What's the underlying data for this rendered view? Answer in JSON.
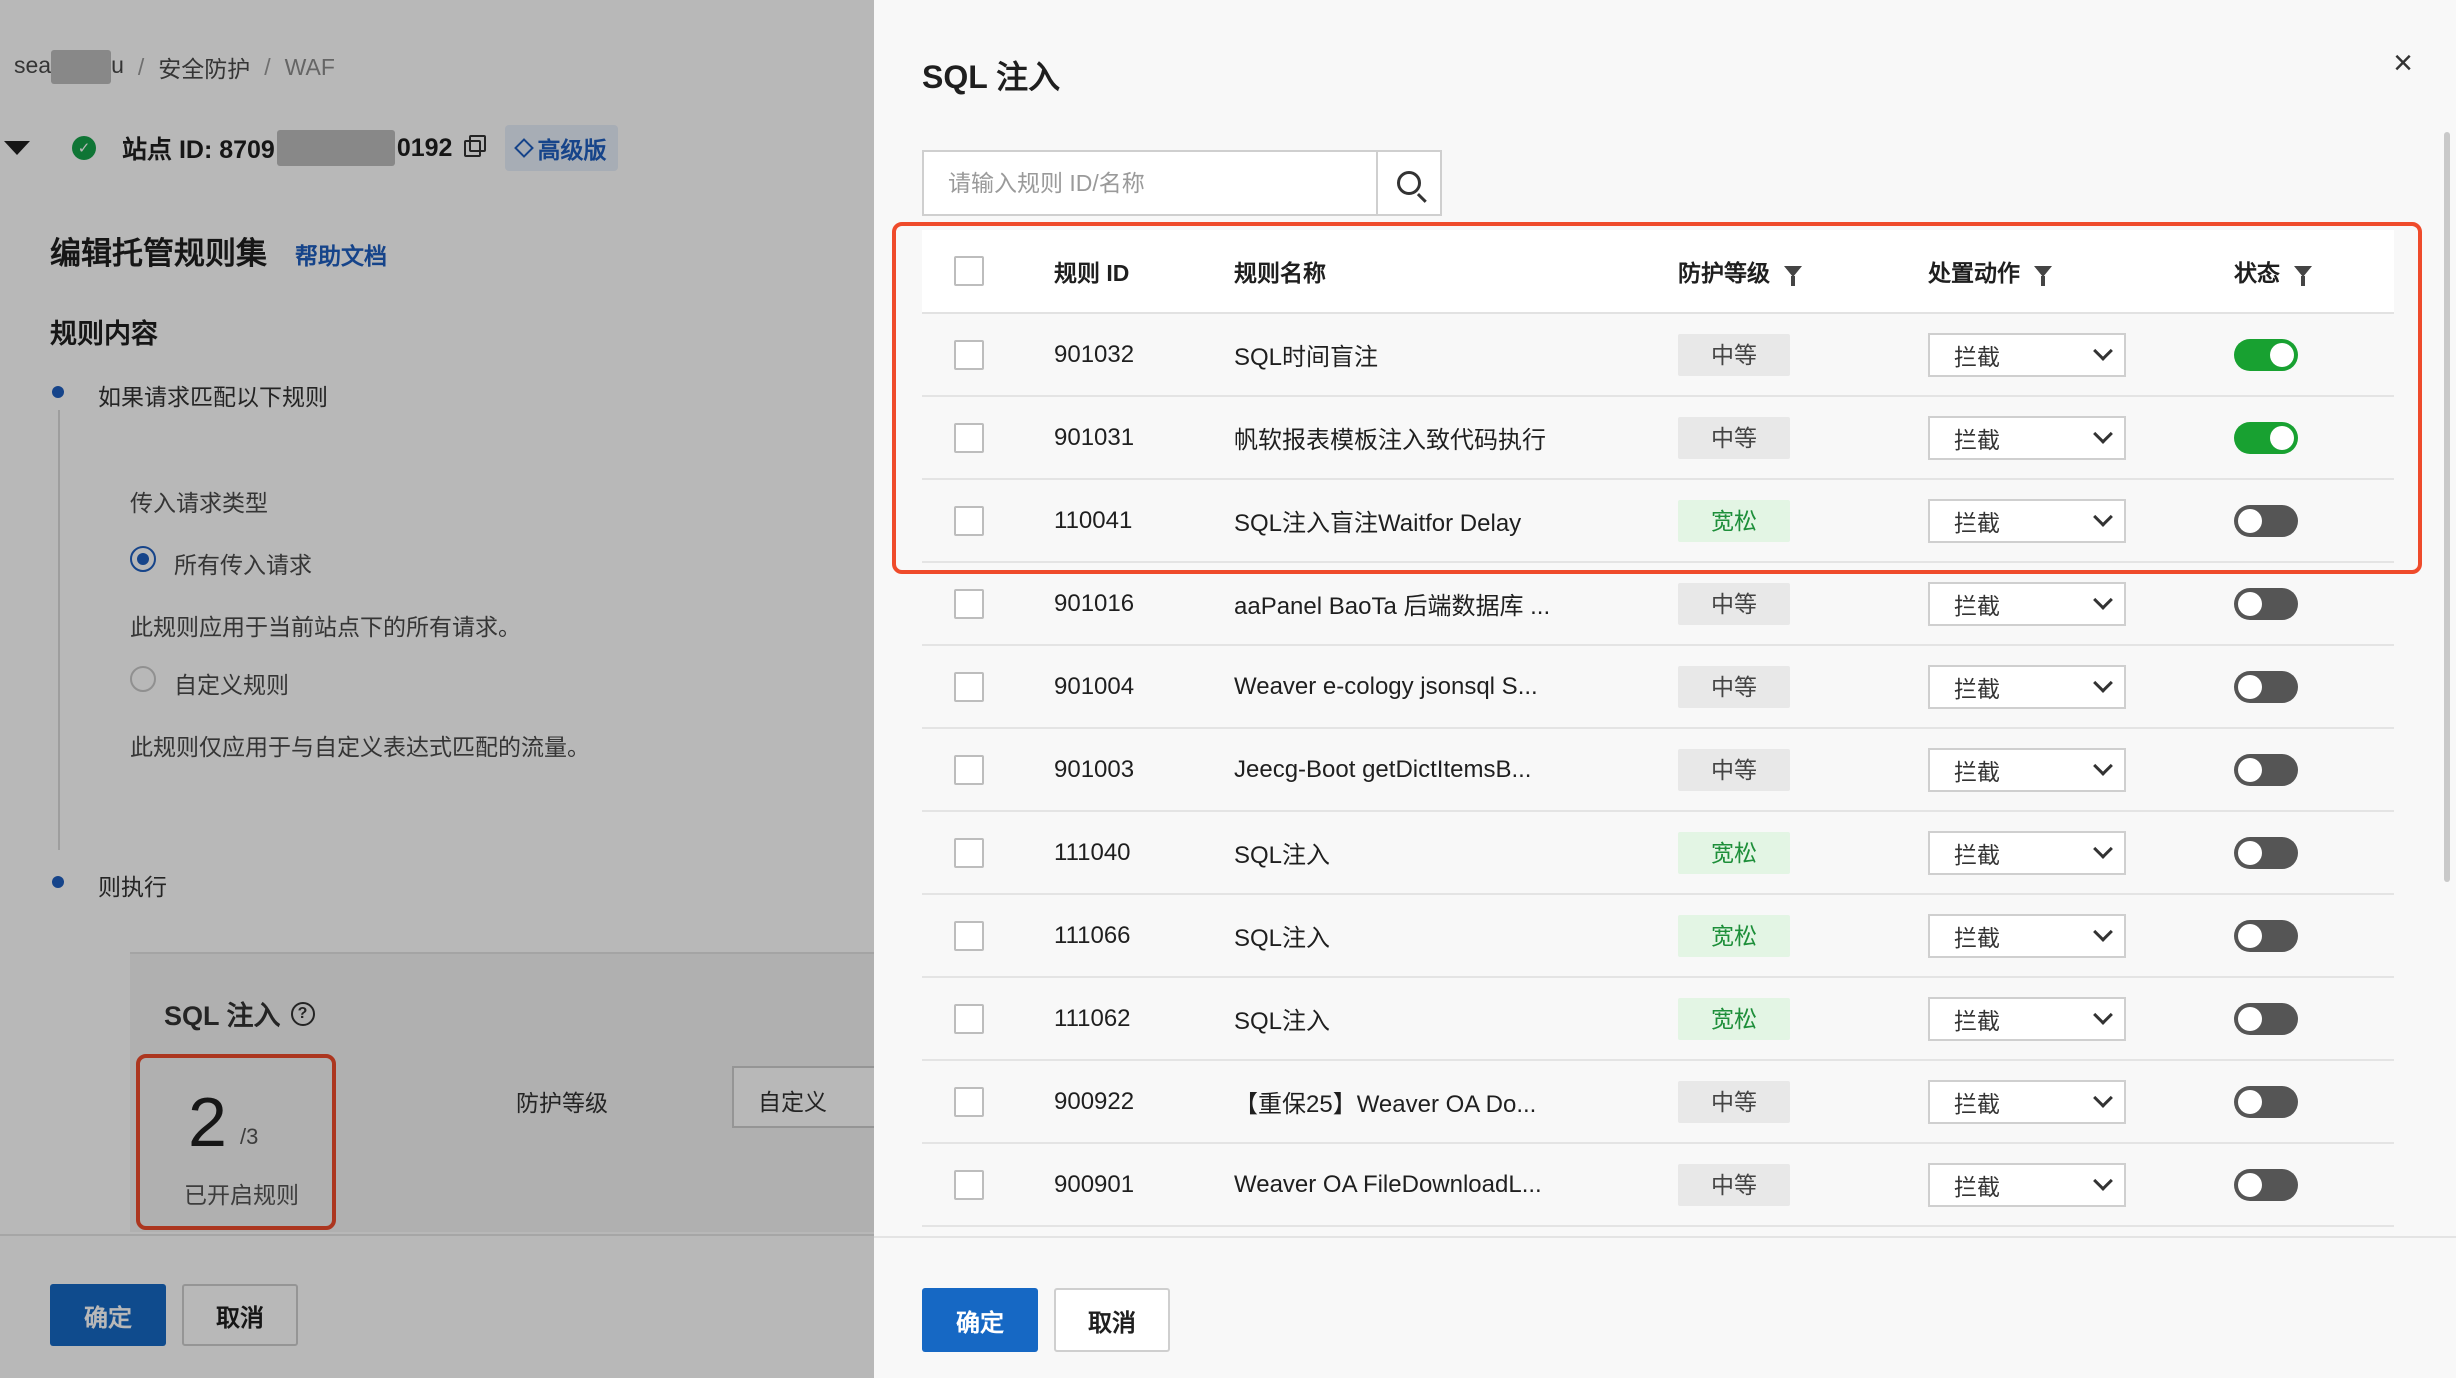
{
  "background": {
    "breadcrumb": {
      "part1": "sea",
      "part2": "u",
      "part3": "安全防护",
      "part4": "WAF"
    },
    "site": {
      "label_prefix": "站点 ID: 8709",
      "label_suffix": "0192",
      "badge": "高级版"
    },
    "edit_title": "编辑托管规则集",
    "help_link": "帮助文档",
    "section_title": "规则内容",
    "if_label": "如果请求匹配以下规则",
    "request_type_label": "传入请求类型",
    "option_all": "所有传入请求",
    "option_all_desc": "此规则应用于当前站点下的所有请求。",
    "option_custom": "自定义规则",
    "option_custom_desc": "此规则仅应用于与自定义表达式匹配的流量。",
    "then_label": "则执行",
    "card": {
      "title": "SQL 注入",
      "enabled_count": "2",
      "enabled_total": "/3",
      "enabled_label": "已开启规则",
      "level_label": "防护等级",
      "level_value": "自定义"
    },
    "footer": {
      "confirm": "确定",
      "cancel": "取消"
    }
  },
  "drawer": {
    "title": "SQL 注入",
    "close": "×",
    "search": {
      "placeholder": "请输入规则 ID/名称"
    },
    "columns": {
      "id": "规则 ID",
      "name": "规则名称",
      "level": "防护等级",
      "action": "处置动作",
      "status": "状态"
    },
    "rows": [
      {
        "id": "901032",
        "name": "SQL时间盲注",
        "level": "中等",
        "level_type": "mid",
        "action": "拦截",
        "status": "on"
      },
      {
        "id": "901031",
        "name": "帆软报表模板注入致代码执行",
        "level": "中等",
        "level_type": "mid",
        "action": "拦截",
        "status": "on"
      },
      {
        "id": "110041",
        "name": "SQL注入盲注Waitfor Delay",
        "level": "宽松",
        "level_type": "low",
        "action": "拦截",
        "status": "off"
      },
      {
        "id": "901016",
        "name": "aaPanel BaoTa 后端数据库 ...",
        "level": "中等",
        "level_type": "mid",
        "action": "拦截",
        "status": "off"
      },
      {
        "id": "901004",
        "name": "Weaver e-cology jsonsql S...",
        "level": "中等",
        "level_type": "mid",
        "action": "拦截",
        "status": "off"
      },
      {
        "id": "901003",
        "name": "Jeecg-Boot getDictItemsB...",
        "level": "中等",
        "level_type": "mid",
        "action": "拦截",
        "status": "off"
      },
      {
        "id": "111040",
        "name": "SQL注入",
        "level": "宽松",
        "level_type": "low",
        "action": "拦截",
        "status": "off"
      },
      {
        "id": "111066",
        "name": "SQL注入",
        "level": "宽松",
        "level_type": "low",
        "action": "拦截",
        "status": "off"
      },
      {
        "id": "111062",
        "name": "SQL注入",
        "level": "宽松",
        "level_type": "low",
        "action": "拦截",
        "status": "off"
      },
      {
        "id": "900922",
        "name": "【重保25】Weaver OA Do...",
        "level": "中等",
        "level_type": "mid",
        "action": "拦截",
        "status": "off"
      },
      {
        "id": "900901",
        "name": "Weaver OA FileDownloadL...",
        "level": "中等",
        "level_type": "mid",
        "action": "拦截",
        "status": "off"
      }
    ],
    "footer": {
      "confirm": "确定",
      "cancel": "取消"
    }
  },
  "colors": {
    "primary": "#1668c4",
    "highlight": "#ef4b2b",
    "switch_on": "#18a131",
    "switch_off": "#555555"
  }
}
